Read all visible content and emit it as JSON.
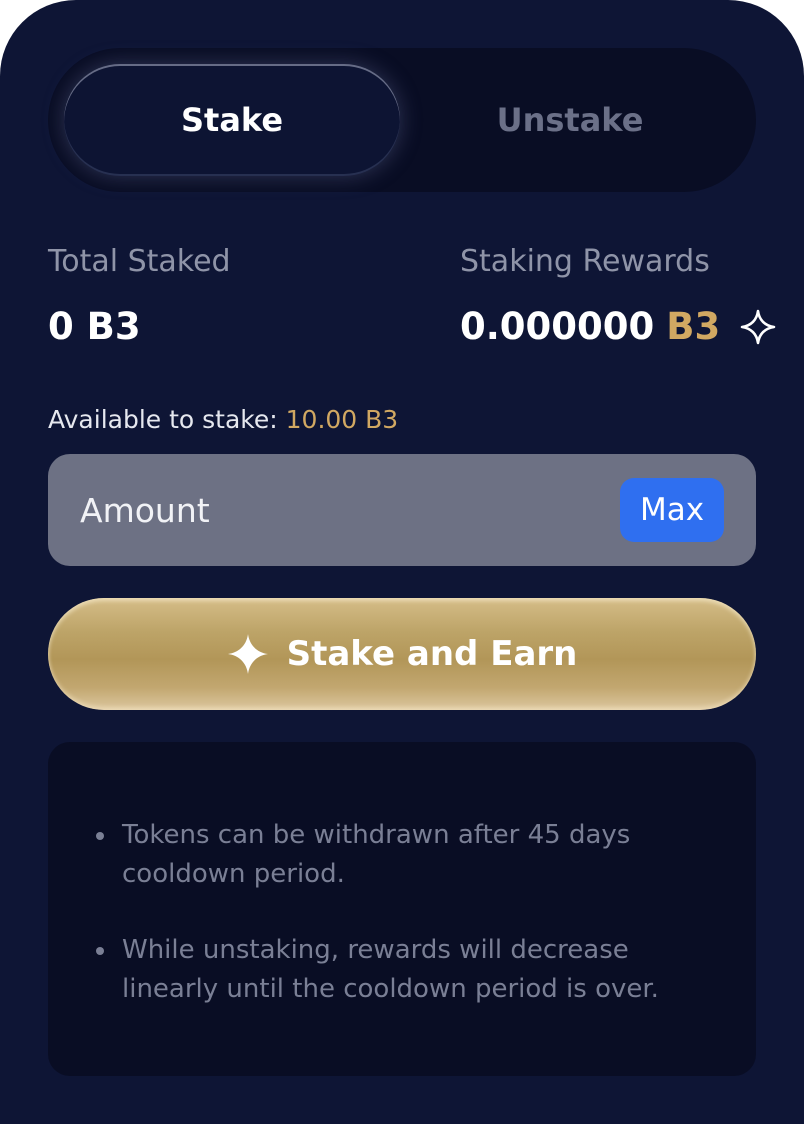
{
  "tabs": {
    "stake_label": "Stake",
    "unstake_label": "Unstake",
    "active": "Stake"
  },
  "stats": {
    "total_staked_label": "Total Staked",
    "total_staked_value": "0 B3",
    "rewards_label": "Staking Rewards",
    "rewards_amount": "0.000000",
    "rewards_token": "B3"
  },
  "available": {
    "label": "Available to stake:",
    "value": "10.00 B3"
  },
  "amount_input": {
    "placeholder": "Amount",
    "value": "",
    "max_label": "Max"
  },
  "action": {
    "stake_button_label": "Stake and Earn"
  },
  "info": {
    "notes": [
      "Tokens can be withdrawn after 45 days cooldown period.",
      "While unstaking, rewards will decrease linearly until the cooldown period is over."
    ]
  },
  "colors": {
    "background": "#0e1535",
    "panel_dark": "#090d24",
    "accent_gold": "#d1a862",
    "max_blue": "#2f6ff0",
    "input_gray": "#6d7184"
  },
  "icons": {
    "rewards_icon": "sparkle-outline-icon",
    "stake_button_icon": "sparkle-filled-icon"
  }
}
